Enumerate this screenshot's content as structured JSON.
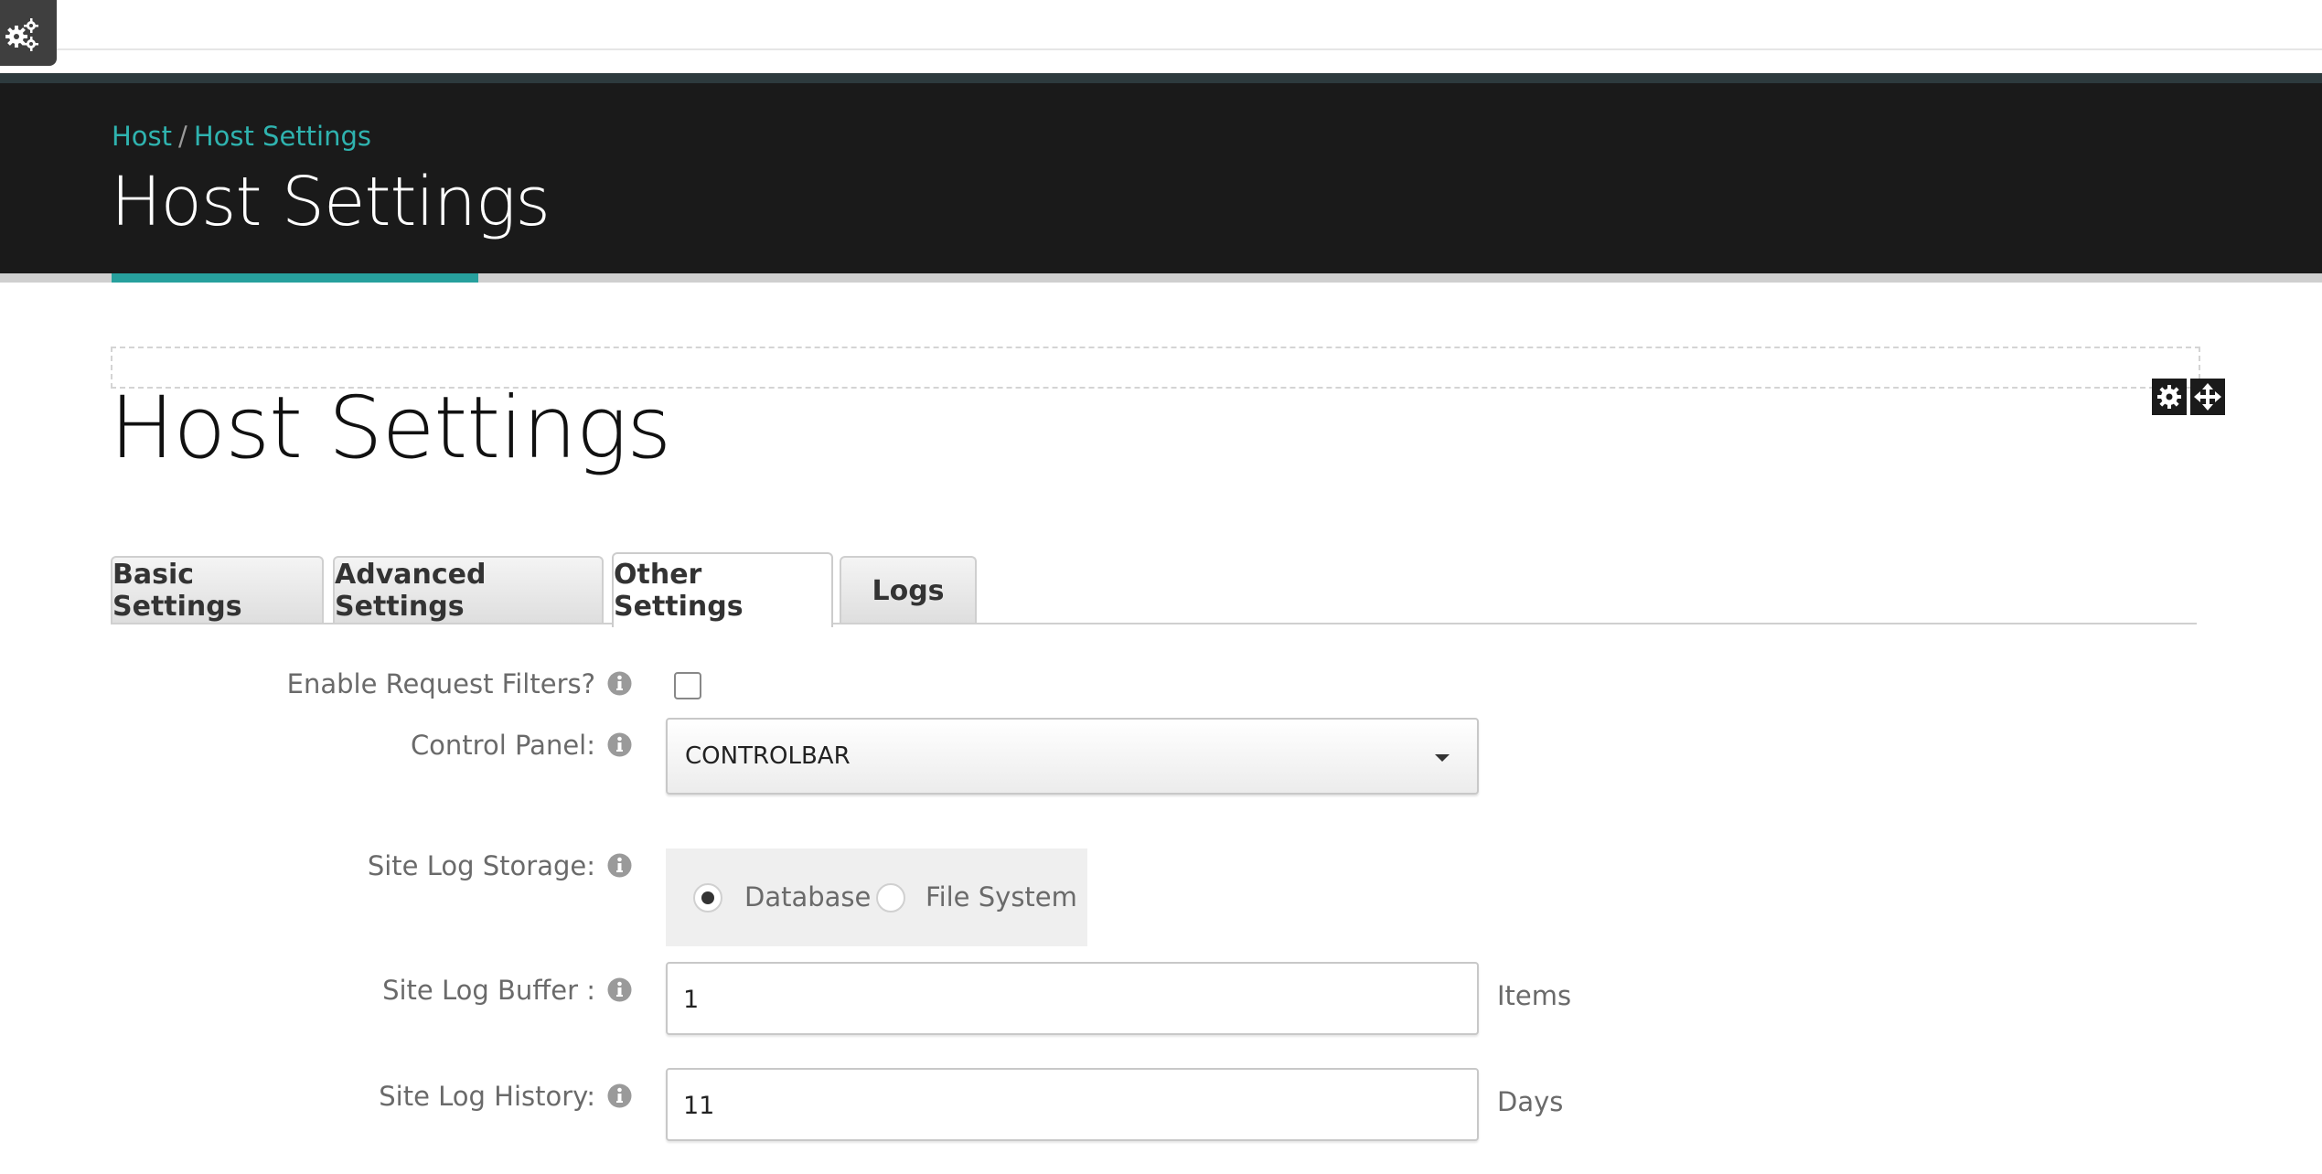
{
  "admin": {
    "settings_icon": "gears-icon"
  },
  "breadcrumb": {
    "root": "Host",
    "separator": "/",
    "current": "Host Settings"
  },
  "hero": {
    "title": "Host Settings"
  },
  "pane": {
    "actions": [
      "gear-icon",
      "move-icon"
    ]
  },
  "module": {
    "title": "Host Settings"
  },
  "tabs": [
    {
      "label": "Basic Settings",
      "active": false
    },
    {
      "label": "Advanced Settings",
      "active": false
    },
    {
      "label": "Other Settings",
      "active": true
    },
    {
      "label": "Logs",
      "active": false
    }
  ],
  "form": {
    "request_filters": {
      "label": "Enable Request Filters?",
      "checked": false
    },
    "control_panel": {
      "label": "Control Panel:",
      "value": "CONTROLBAR"
    },
    "site_log_storage": {
      "label": "Site Log Storage:",
      "options": [
        "Database",
        "File System"
      ],
      "selected": "Database"
    },
    "site_log_buffer": {
      "label": "Site Log Buffer :",
      "value": "1",
      "suffix": "Items"
    },
    "site_log_history": {
      "label": "Site Log History:",
      "value": "11",
      "suffix": "Days"
    }
  },
  "colors": {
    "accent": "#27a09d",
    "link": "#2fb3af",
    "hero_bg": "#1a1a1a"
  }
}
